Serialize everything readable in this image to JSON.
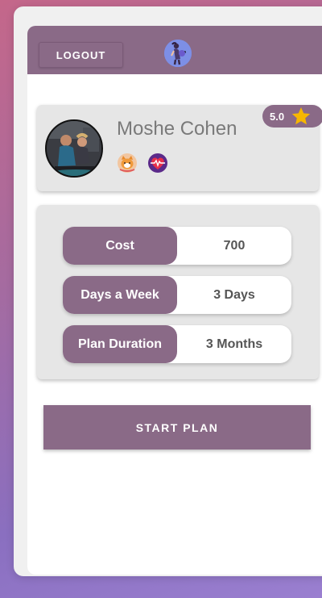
{
  "header": {
    "logout_label": "LOGOUT",
    "logo_icon": "fitness-logo-icon"
  },
  "profile": {
    "name": "Moshe Cohen",
    "rating": "5.0",
    "rating_icon": "star-icon",
    "badges": [
      "cat-badge-icon",
      "heartbeat-badge-icon"
    ]
  },
  "plan_details": [
    {
      "label": "Cost",
      "value": "700"
    },
    {
      "label": "Days a Week",
      "value": "3 Days"
    },
    {
      "label": "Plan Duration",
      "value": "3 Months"
    }
  ],
  "actions": {
    "start_plan_label": "START PLAN"
  },
  "colors": {
    "primary": "#8a6a87",
    "card_bg": "#e6e6e6",
    "star": "#f6b700",
    "logo_bg": "#7d8fe6"
  }
}
